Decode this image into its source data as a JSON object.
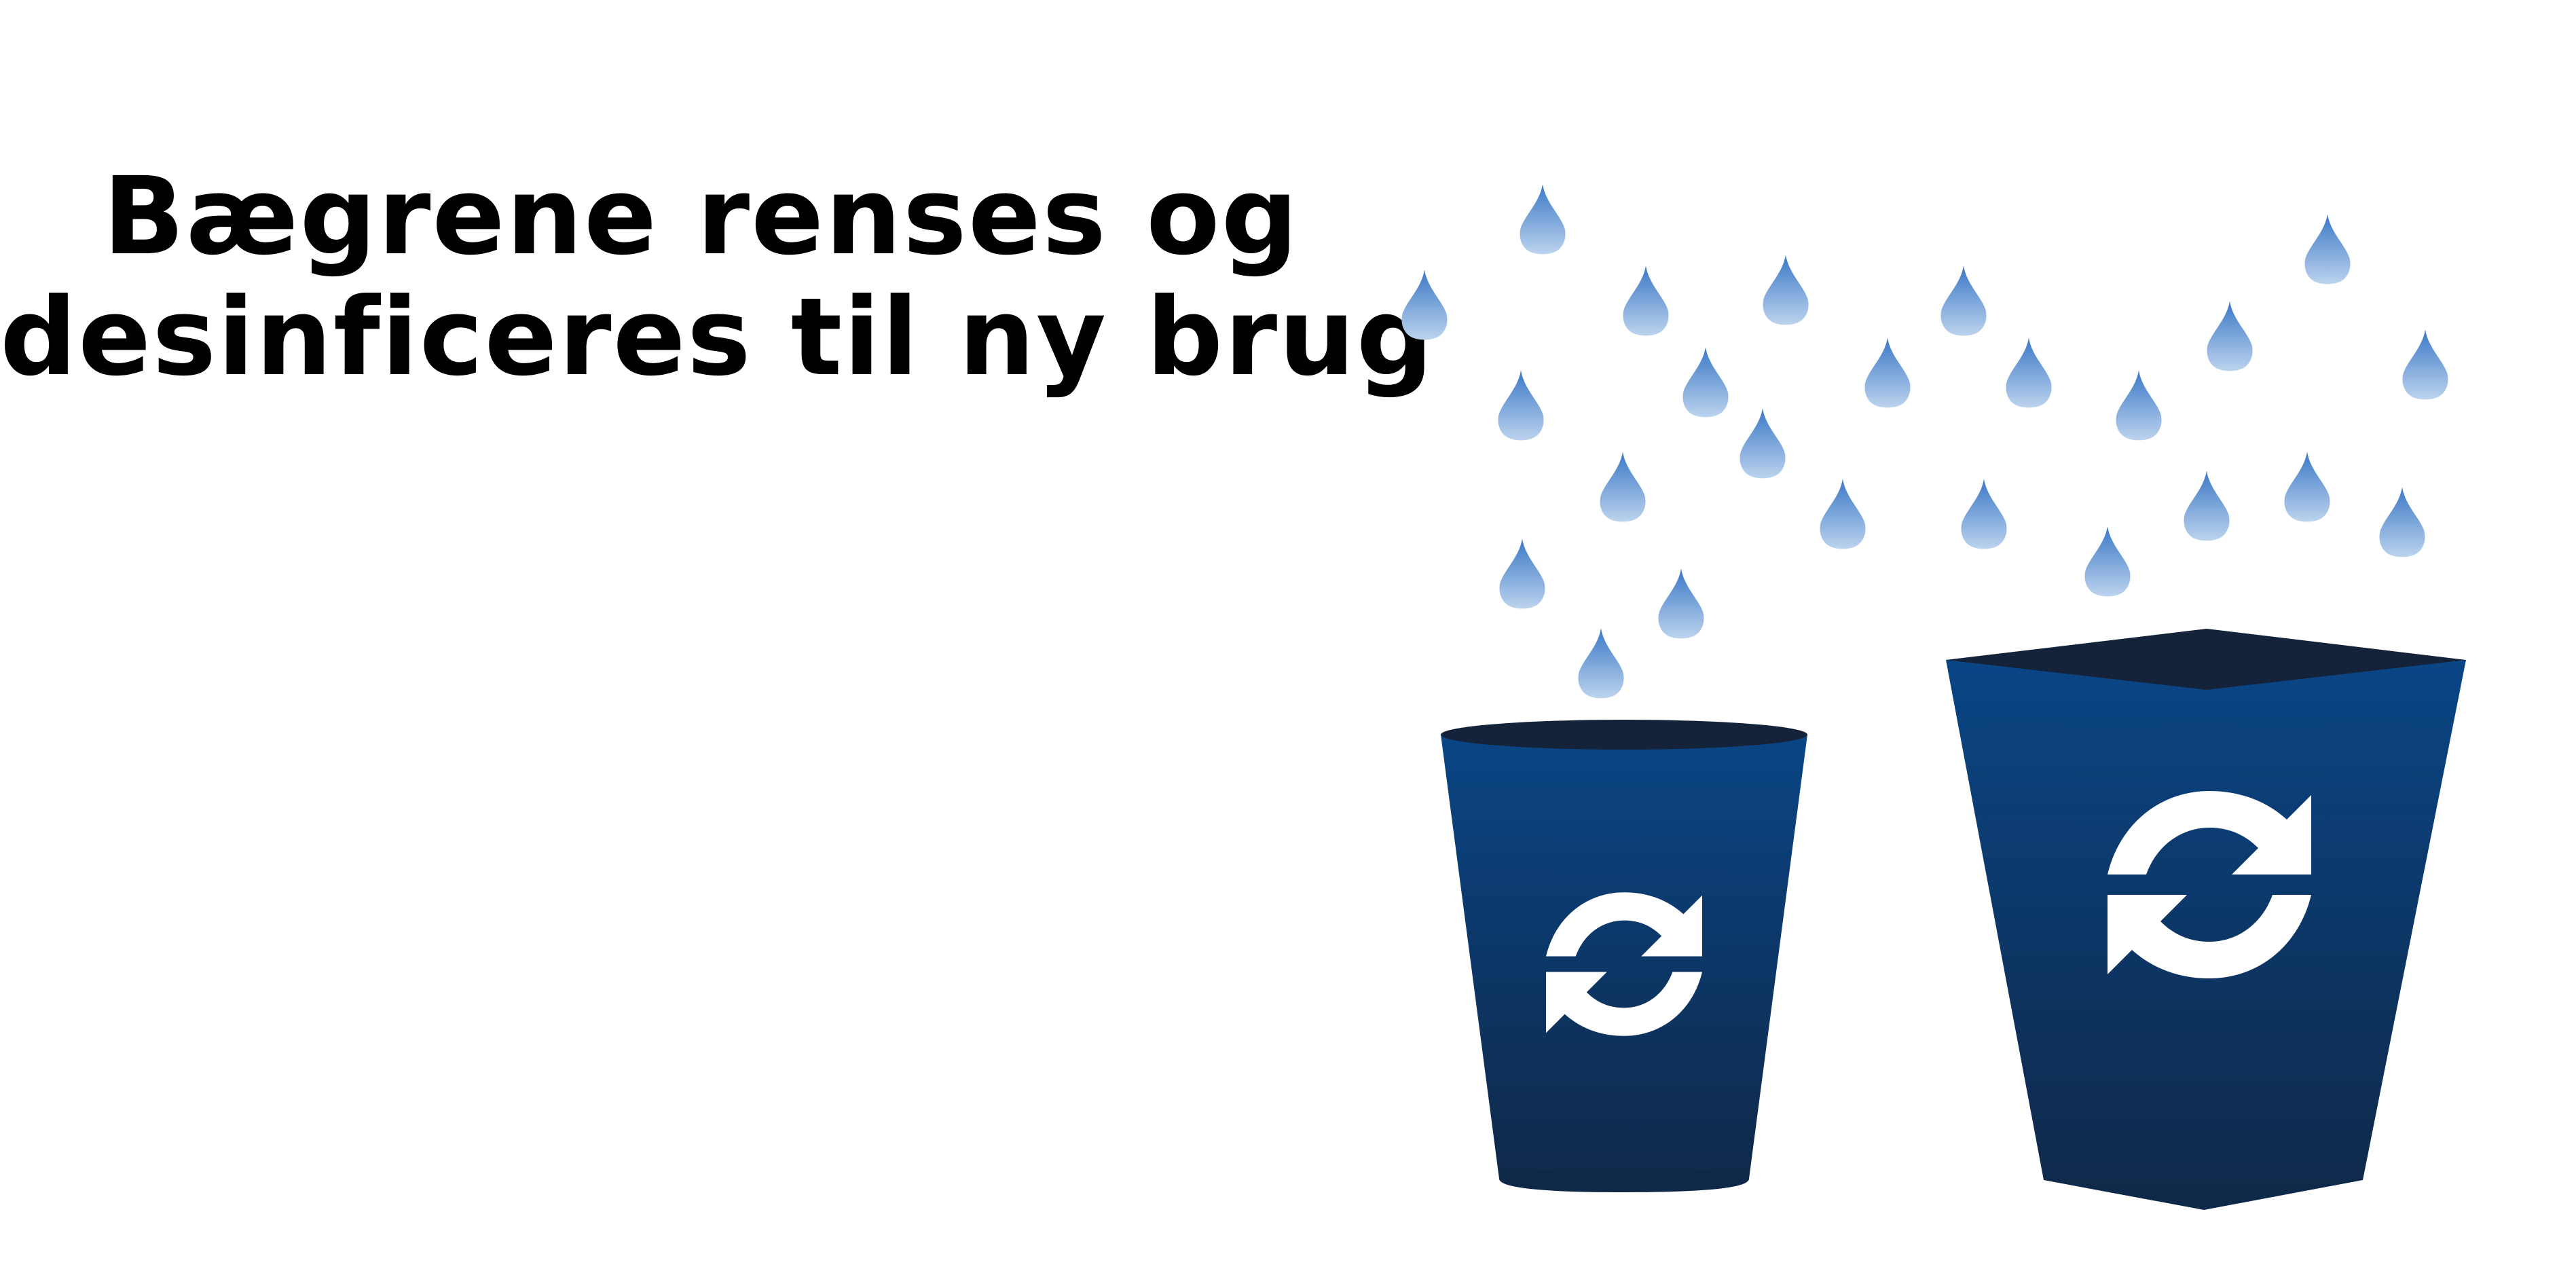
{
  "headline": {
    "line1": "Bægrene renses og",
    "line2": "desinficeres til ny brug"
  },
  "illustration": {
    "elements": [
      "water-drops",
      "small-cup",
      "large-cup",
      "refresh-icon"
    ],
    "cups": [
      {
        "name": "small-cup",
        "icon": "refresh-icon"
      },
      {
        "name": "large-cup",
        "icon": "refresh-icon"
      }
    ],
    "colors": {
      "cup_top": "#0a4585",
      "cup_bottom": "#0f2848",
      "cup_rim": "#142339",
      "drop_top": "#3b78c6",
      "drop_bottom": "#bcd3ee",
      "icon": "#ffffff",
      "text": "#000000",
      "background": "#ffffff"
    }
  }
}
